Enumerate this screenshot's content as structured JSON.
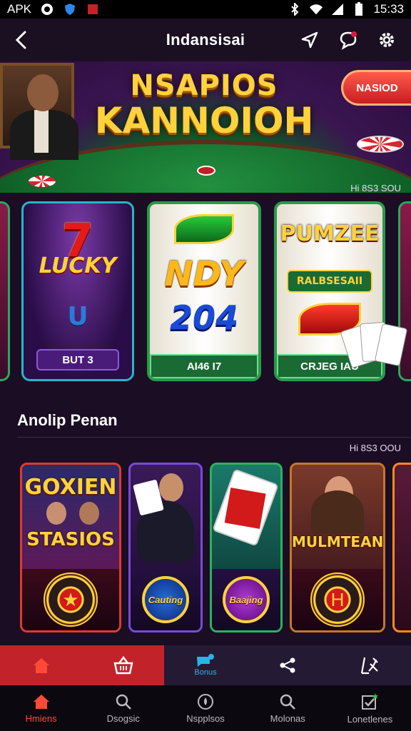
{
  "status_bar": {
    "carrier": "APK",
    "time": "15:33"
  },
  "app_bar": {
    "title": "Indansisai",
    "icons": [
      "back-arrow-icon",
      "send-icon",
      "chat-icon",
      "settings-icon"
    ]
  },
  "hero": {
    "logo_line1": "NSAPIOS",
    "logo_line2": "KANNOIOH",
    "button_label": "NASIOD"
  },
  "jackpot_top": "Hi 8S3 SOU",
  "slots": [
    {
      "top": "7",
      "middle": "LUCKY",
      "bottom": "U",
      "label": "BUT 3"
    },
    {
      "middle": "NDY",
      "bottom": "204",
      "label": "AI46 I7"
    },
    {
      "top": "PUMZEE",
      "middle": "RALBSESAII",
      "label": "CRJEG IAU"
    }
  ],
  "section": {
    "title": "Anolip Penan",
    "jackpot": "Hi 8S3 OOU"
  },
  "games": [
    {
      "art_top": "GOXIEN",
      "art_bottom": "STASIOS"
    },
    {
      "chip_label": "Cauting"
    },
    {
      "chip_label": "Baajing"
    },
    {
      "art": "MULMTEAN"
    }
  ],
  "tab_strip": [
    {
      "icon": "home-icon"
    },
    {
      "icon": "basket-icon"
    },
    {
      "icon": "chat-bubble-icon",
      "label": "Bonus"
    },
    {
      "icon": "share-icon"
    },
    {
      "icon": "tools-icon"
    }
  ],
  "bottom_nav": [
    {
      "icon": "home-icon",
      "label": "Hmiens"
    },
    {
      "icon": "search-icon",
      "label": "Dsogsic"
    },
    {
      "icon": "drop-icon",
      "label": "Nspplsos"
    },
    {
      "icon": "search-icon",
      "label": "Molonas"
    },
    {
      "icon": "task-icon",
      "label": "Lonetlenes"
    }
  ],
  "colors": {
    "accent_red": "#c2232a",
    "accent_gold": "#ffd23c",
    "background": "#1a0d24",
    "active_blue": "#2ab3e8"
  }
}
